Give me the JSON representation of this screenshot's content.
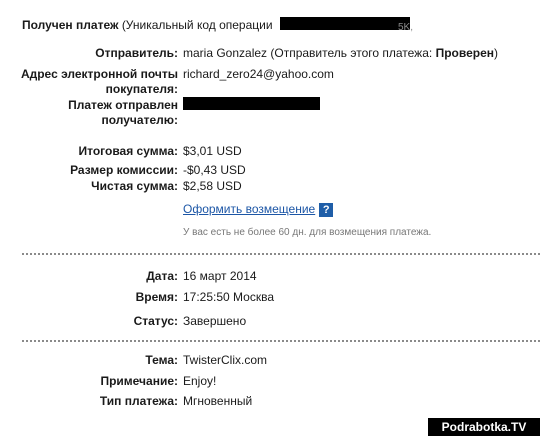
{
  "header": {
    "title": "Получен платеж",
    "subtitle": "(Уникальный код операции",
    "subtitle_end": "5K,"
  },
  "details": {
    "sender_label": "Отправитель:",
    "sender_value": "maria Gonzalez (Отправитель этого платежа:",
    "sender_status": "Проверен",
    "sender_close": ")",
    "email_label_1": "Адрес электронной почты",
    "email_label_2": "покупателя:",
    "email_value": "richard_zero24@yahoo.com",
    "sentto_label_1": "Платеж отправлен",
    "sentto_label_2": "получателю:"
  },
  "amounts": {
    "total_label": "Итоговая сумма:",
    "total_value": "$3,01 USD",
    "fee_label": "Размер комиссии:",
    "fee_value": "-$0,43 USD",
    "net_label": "Чистая сумма:",
    "net_value": "$2,58 USD",
    "refund_link": "Оформить возмещение",
    "help_icon": "?",
    "refund_note": "У вас есть не более 60 дн. для возмещения платежа."
  },
  "datetime": {
    "date_label": "Дата:",
    "date_value": "16 март 2014",
    "time_label": "Время:",
    "time_value": "17:25:50 Москва",
    "status_label": "Статус:",
    "status_value": "Завершено"
  },
  "info": {
    "subject_label": "Тема:",
    "subject_value": "TwisterClix.com",
    "note_label": "Примечание:",
    "note_value": "Enjoy!",
    "type_label": "Тип платежа:",
    "type_value": "Мгновенный"
  },
  "watermark": "Podrabotka.TV",
  "colors": {
    "link": "#1c56a6",
    "help_bg": "#1f5ea8",
    "divider": "#8a8a8a"
  }
}
